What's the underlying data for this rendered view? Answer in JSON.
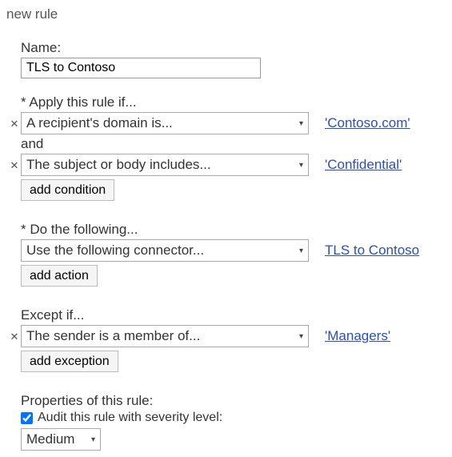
{
  "title": "new rule",
  "name_label": "Name:",
  "name_value": "TLS to Contoso",
  "conditions": {
    "header": "* Apply this rule if...",
    "and_label": "and",
    "items": [
      {
        "selected": "A recipient's domain is...",
        "value_link": "'Contoso.com'"
      },
      {
        "selected": "The subject or body includes...",
        "value_link": "'Confidential'"
      }
    ],
    "add_label": "add condition"
  },
  "actions": {
    "header": "* Do the following...",
    "items": [
      {
        "selected": "Use the following connector...",
        "value_link": "TLS to Contoso"
      }
    ],
    "add_label": "add action"
  },
  "exceptions": {
    "header": "Except if...",
    "items": [
      {
        "selected": "The sender is a member of...",
        "value_link": "'Managers'"
      }
    ],
    "add_label": "add exception"
  },
  "properties": {
    "header": "Properties of this rule:",
    "audit_label": "Audit this rule with severity level:",
    "audit_checked": true,
    "severity_value": "Medium"
  },
  "glyphs": {
    "remove": "✕",
    "caret": "▾"
  }
}
